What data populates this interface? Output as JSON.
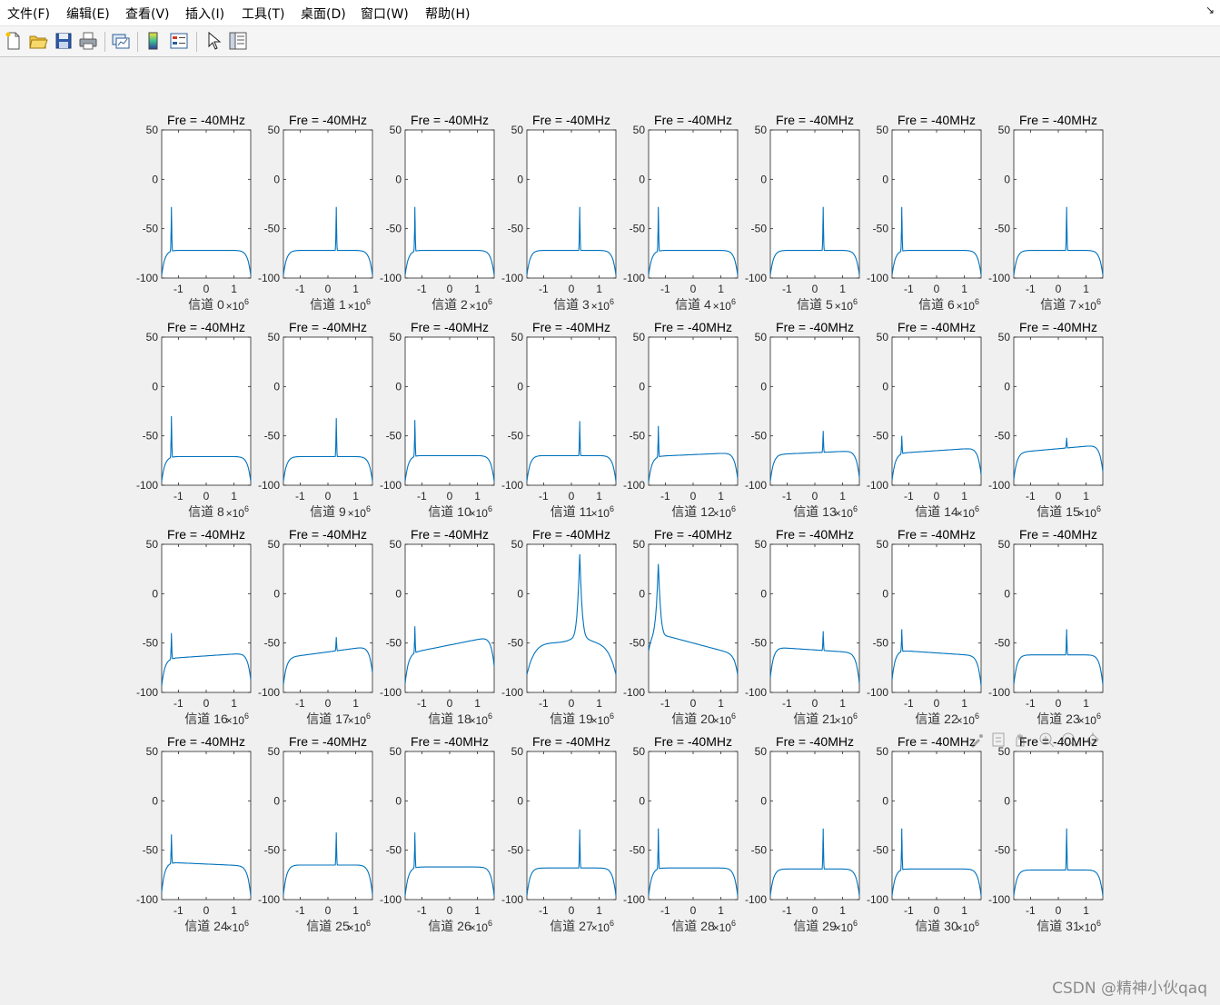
{
  "menu": [
    "文件(F)",
    "编辑(E)",
    "查看(V)",
    "插入(I)",
    "工具(T)",
    "桌面(D)",
    "窗口(W)",
    "帮助(H)"
  ],
  "toolbar": {
    "icons": [
      "new-figure-icon",
      "open-file-icon",
      "save-icon",
      "print-icon",
      "link-plot-icon",
      "colorbar-icon",
      "legend-icon",
      "edit-plot-arrow-icon",
      "property-inspector-icon"
    ]
  },
  "axes_toolbar": {
    "icons": [
      "brush-icon",
      "data-tips-icon",
      "pan-hand-icon",
      "zoom-in-icon",
      "zoom-out-icon",
      "restore-view-icon"
    ]
  },
  "watermark": "CSDN @精神小伙qaq",
  "colors": {
    "line": "#0072bd",
    "axes_background": "#ffffff",
    "figure_background": "#f0f0f0",
    "tick_text": "#262626"
  },
  "chart_data": {
    "type": "line",
    "layout": "4x8 subplot grid",
    "subplot_title": "Fre = -40MHz",
    "xlim": [
      -1.6,
      1.6
    ],
    "ylim": [
      -100,
      50
    ],
    "xticks": [
      -1,
      0,
      1
    ],
    "yticks": [
      50,
      0,
      -50,
      -100
    ],
    "x_exponent_label": "×10^6",
    "grid": false,
    "series_color": "#0072bd",
    "subplots": [
      {
        "xlabel": "信道 0",
        "spike_x": -1.25,
        "spike_peak": -28,
        "floor": -72,
        "tilt": 0,
        "edge_y": -97
      },
      {
        "xlabel": "信道 1",
        "spike_x": 0.3,
        "spike_peak": -28,
        "floor": -72,
        "tilt": 0,
        "edge_y": -97
      },
      {
        "xlabel": "信道 2",
        "spike_x": -1.25,
        "spike_peak": -28,
        "floor": -72,
        "tilt": 0,
        "edge_y": -97
      },
      {
        "xlabel": "信道 3",
        "spike_x": 0.3,
        "spike_peak": -28,
        "floor": -72,
        "tilt": 0,
        "edge_y": -97
      },
      {
        "xlabel": "信道 4",
        "spike_x": -1.25,
        "spike_peak": -28,
        "floor": -72,
        "tilt": 0,
        "edge_y": -97
      },
      {
        "xlabel": "信道 5",
        "spike_x": 0.3,
        "spike_peak": -28,
        "floor": -72,
        "tilt": 0,
        "edge_y": -97
      },
      {
        "xlabel": "信道 6",
        "spike_x": -1.25,
        "spike_peak": -28,
        "floor": -72,
        "tilt": 0,
        "edge_y": -97
      },
      {
        "xlabel": "信道 7",
        "spike_x": 0.3,
        "spike_peak": -28,
        "floor": -72,
        "tilt": 0,
        "edge_y": -97
      },
      {
        "xlabel": "信道 8",
        "spike_x": -1.25,
        "spike_peak": -30,
        "floor": -71,
        "tilt": 0,
        "edge_y": -96
      },
      {
        "xlabel": "信道 9",
        "spike_x": 0.3,
        "spike_peak": -32,
        "floor": -71,
        "tilt": 0,
        "edge_y": -96
      },
      {
        "xlabel": "信道 10",
        "spike_x": -1.25,
        "spike_peak": -34,
        "floor": -70,
        "tilt": 0,
        "edge_y": -96
      },
      {
        "xlabel": "信道 11",
        "spike_x": 0.3,
        "spike_peak": -35,
        "floor": -70,
        "tilt": 0,
        "edge_y": -96
      },
      {
        "xlabel": "信道 12",
        "spike_x": -1.25,
        "spike_peak": -40,
        "floor": -69,
        "tilt": 2,
        "edge_y": -95
      },
      {
        "xlabel": "信道 13",
        "spike_x": 0.3,
        "spike_peak": -45,
        "floor": -67,
        "tilt": 2,
        "edge_y": -94
      },
      {
        "xlabel": "信道 14",
        "spike_x": -1.25,
        "spike_peak": -50,
        "floor": -65,
        "tilt": 3,
        "edge_y": -92
      },
      {
        "xlabel": "信道 15",
        "spike_x": 0.3,
        "spike_peak": -52,
        "floor": -63,
        "tilt": 4,
        "edge_y": -90
      },
      {
        "xlabel": "信道 16",
        "spike_x": -1.25,
        "spike_peak": -40,
        "floor": -63,
        "tilt": 3,
        "edge_y": -90
      },
      {
        "xlabel": "信道 17",
        "spike_x": 0.3,
        "spike_peak": -44,
        "floor": -59,
        "tilt": 6,
        "edge_y": -86
      },
      {
        "xlabel": "信道 18",
        "spike_x": -1.25,
        "spike_peak": -33,
        "floor": -52,
        "tilt": 9,
        "edge_y": -82
      },
      {
        "xlabel": "信道 19",
        "spike_x": 0.3,
        "spike_peak": 40,
        "floor": -50,
        "tilt": 0,
        "edge_y": -82,
        "shape": "peak"
      },
      {
        "xlabel": "信道 20",
        "spike_x": -1.25,
        "spike_peak": 30,
        "floor": -50,
        "tilt": -12,
        "edge_y": -70,
        "shape": "skew"
      },
      {
        "xlabel": "信道 21",
        "spike_x": 0.3,
        "spike_peak": -38,
        "floor": -57,
        "tilt": -3,
        "edge_y": -88
      },
      {
        "xlabel": "信道 22",
        "spike_x": -1.25,
        "spike_peak": -36,
        "floor": -60,
        "tilt": -3,
        "edge_y": -90
      },
      {
        "xlabel": "信道 23",
        "spike_x": 0.3,
        "spike_peak": -36,
        "floor": -62,
        "tilt": 0,
        "edge_y": -92
      },
      {
        "xlabel": "信道 24",
        "spike_x": -1.25,
        "spike_peak": -34,
        "floor": -64,
        "tilt": -2,
        "edge_y": -94
      },
      {
        "xlabel": "信道 25",
        "spike_x": 0.3,
        "spike_peak": -32,
        "floor": -65,
        "tilt": 0,
        "edge_y": -95
      },
      {
        "xlabel": "信道 26",
        "spike_x": -1.25,
        "spike_peak": -32,
        "floor": -67,
        "tilt": 0,
        "edge_y": -96
      },
      {
        "xlabel": "信道 27",
        "spike_x": 0.3,
        "spike_peak": -29,
        "floor": -68,
        "tilt": 0,
        "edge_y": -96
      },
      {
        "xlabel": "信道 28",
        "spike_x": -1.25,
        "spike_peak": -28,
        "floor": -68,
        "tilt": 0,
        "edge_y": -96
      },
      {
        "xlabel": "信道 29",
        "spike_x": 0.3,
        "spike_peak": -28,
        "floor": -69,
        "tilt": 0,
        "edge_y": -96
      },
      {
        "xlabel": "信道 30",
        "spike_x": -1.25,
        "spike_peak": -28,
        "floor": -69,
        "tilt": 0,
        "edge_y": -96
      },
      {
        "xlabel": "信道 31",
        "spike_x": 0.3,
        "spike_peak": -28,
        "floor": -70,
        "tilt": 0,
        "edge_y": -96
      }
    ]
  }
}
